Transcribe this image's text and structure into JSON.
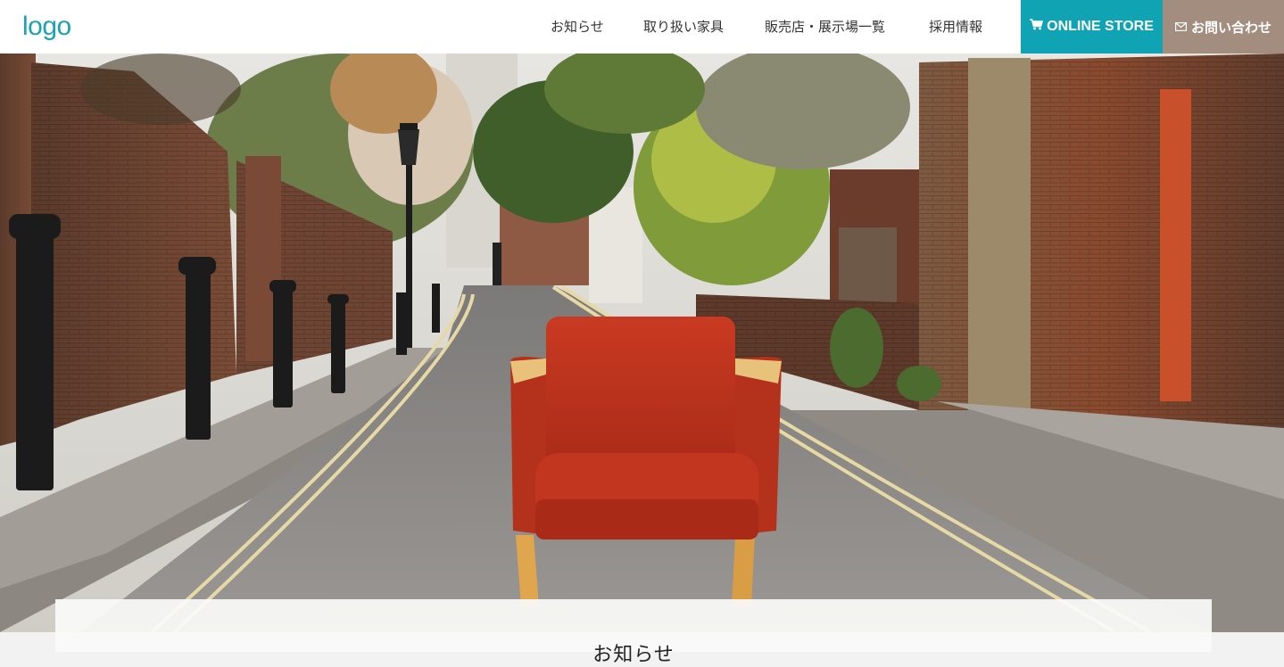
{
  "header": {
    "logo": "logo",
    "nav": [
      {
        "label": "お知らせ"
      },
      {
        "label": "取り扱い家具"
      },
      {
        "label": "販売店・展示場一覧"
      },
      {
        "label": "採用情報"
      }
    ],
    "store_button": {
      "label": "ONLINE STORE",
      "icon": "cart-icon"
    },
    "contact_button": {
      "label": "お問い合わせ",
      "icon": "envelope-icon"
    }
  },
  "hero": {
    "image": "red armchair in the middle of a narrow brick-walled street"
  },
  "news": {
    "title": "お知らせ"
  },
  "colors": {
    "brand": "#1aa3b4",
    "store_bg": "#10a3b4",
    "contact_bg": "#a28d7e",
    "nav_text": "#333333"
  }
}
